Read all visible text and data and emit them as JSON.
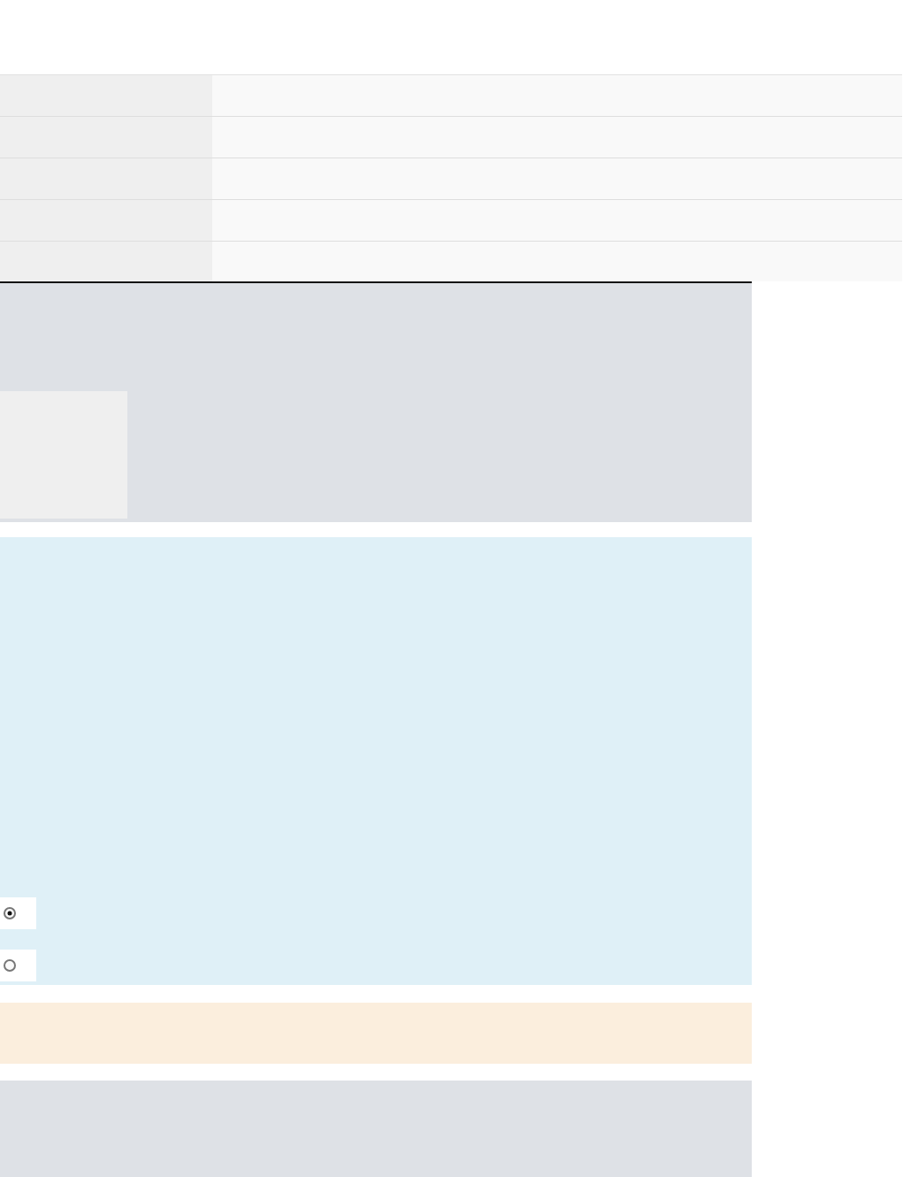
{
  "options_panel": {
    "radios": [
      {
        "selected": true
      },
      {
        "selected": false
      }
    ]
  }
}
